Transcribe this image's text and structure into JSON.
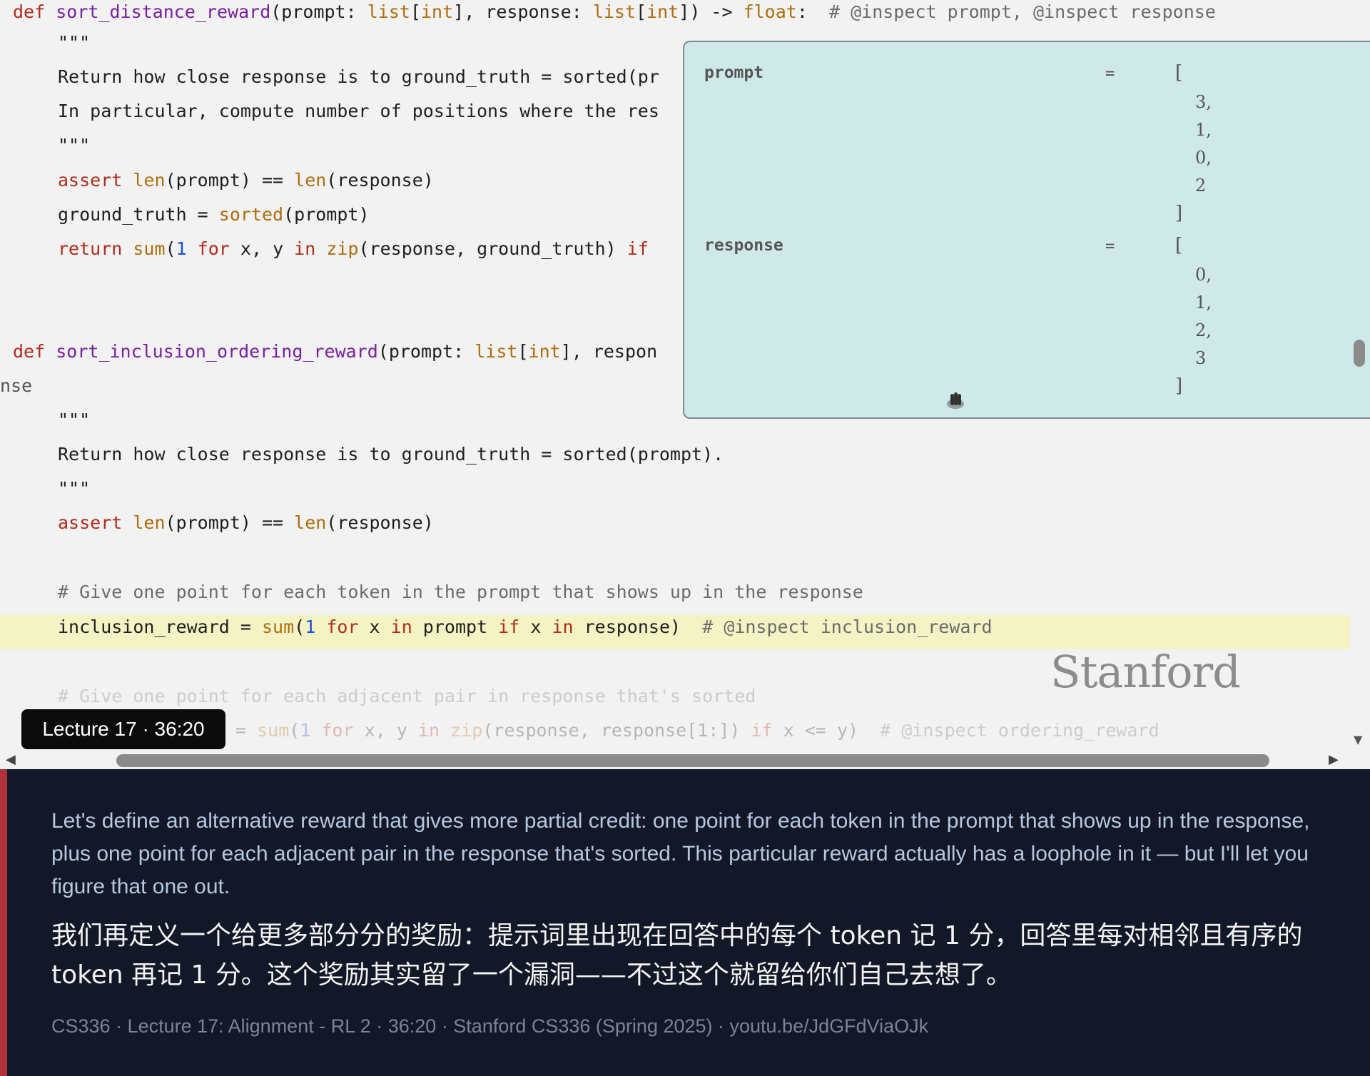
{
  "code": {
    "line1": {
      "def_kw": "def",
      "name": "sort_distance_reward",
      "prompt_param": "(prompt: ",
      "list1": "list",
      "bracket_open1": "[",
      "int1": "int",
      "bracket_close1": "], response: ",
      "list2": "list",
      "bracket_open2": "[",
      "int2": "int",
      "bracket_close2": "]) -> ",
      "float_type": "float",
      "colon": ":  ",
      "comment": "# @inspect prompt, @inspect response"
    },
    "docstring_open1": "\"\"\"",
    "doc_line1": "Return how close response is to ground_truth = sorted(pr",
    "doc_line2": "In particular, compute number of positions where the res",
    "docstring_close1": "\"\"\"",
    "assert1": {
      "assert_kw": "assert ",
      "len1": "len",
      "arg1": "(prompt) == ",
      "len2": "len",
      "arg2": "(response)"
    },
    "gt_line": {
      "lhs": "ground_truth = ",
      "sorted_fn": "sorted",
      "arg": "(prompt)"
    },
    "return_line": {
      "return_kw": "return ",
      "sum_fn": "sum",
      "paren": "(",
      "one": "1",
      "for_kw": " for",
      "vars": " x, y ",
      "in_kw": "in",
      "space": " ",
      "zip_fn": "zip",
      "args": "(response, ground_truth) ",
      "if_kw": "if"
    },
    "line2": {
      "def_kw": "def",
      "name": "sort_inclusion_ordering_reward",
      "prompt_param": "(prompt: ",
      "list1": "list",
      "bracket_open": "[",
      "int1": "int",
      "rest": "], respon"
    },
    "wrap_fragment": "nse",
    "docstring_open2": "\"\"\"",
    "doc_line3": "Return how close response is to ground_truth = sorted(prompt).",
    "docstring_close2": "\"\"\"",
    "assert2": {
      "assert_kw": "assert ",
      "len1": "len",
      "arg1": "(prompt) == ",
      "len2": "len",
      "arg2": "(response)"
    },
    "comment1": "# Give one point for each token in the prompt that shows up in the response",
    "inclusion_line": {
      "lhs": "inclusion_reward = ",
      "sum_fn": "sum",
      "paren": "(",
      "one": "1",
      "for_kw": " for",
      "x1": " x ",
      "in_kw1": "in",
      "prompt": " prompt ",
      "if_kw": "if",
      "x2": " x ",
      "in_kw2": "in",
      "rest": " response)  ",
      "comment": "# @inspect inclusion_reward"
    },
    "comment2": "# Give one point for each adjacent pair in response that's sorted",
    "ordering_line": {
      "lhs": "= ",
      "sum_fn": "sum",
      "paren": "(",
      "one": "1",
      "for_kw": " for",
      "vars": " x, y ",
      "in_kw": "in",
      "space": " ",
      "zip_fn": "zip",
      "rest": "(response, response[1:]) ",
      "if_kw": "if",
      "cond": " x <= y)  ",
      "comment": "# @inspect ordering_reward"
    }
  },
  "inspect_panel": {
    "prompt_label": "prompt",
    "response_label": "response",
    "eq": "=",
    "open_bracket": "[",
    "close_bracket": "]",
    "prompt_values": [
      "3,",
      "1,",
      "0,",
      "2"
    ],
    "response_values": [
      "0,",
      "1,",
      "2,",
      "3"
    ]
  },
  "badge": "Lecture 17 · 36:20",
  "watermark": "Stanford",
  "scroll_arrows": {
    "down": "▼",
    "left": "◀",
    "right": "▶"
  },
  "caption": {
    "english": "Let's define an alternative reward that gives more partial credit: one point for each token in the prompt that shows up in the response, plus one point for each adjacent pair in the response that's sorted. This particular reward actually has a loophole in it — but I'll let you figure that one out.",
    "chinese": "我们再定义一个给更多部分分的奖励：提示词里出现在回答中的每个 token 记 1 分，回答里每对相邻且有序的 token 再记 1 分。这个奖励其实留了一个漏洞——不过这个就留给你们自己去想了。",
    "meta": "CS336  ·  Lecture 17: Alignment - RL 2  ·  36:20  ·  Stanford CS336 (Spring 2025)  ·  youtu.be/JdGFdViaOJk"
  }
}
